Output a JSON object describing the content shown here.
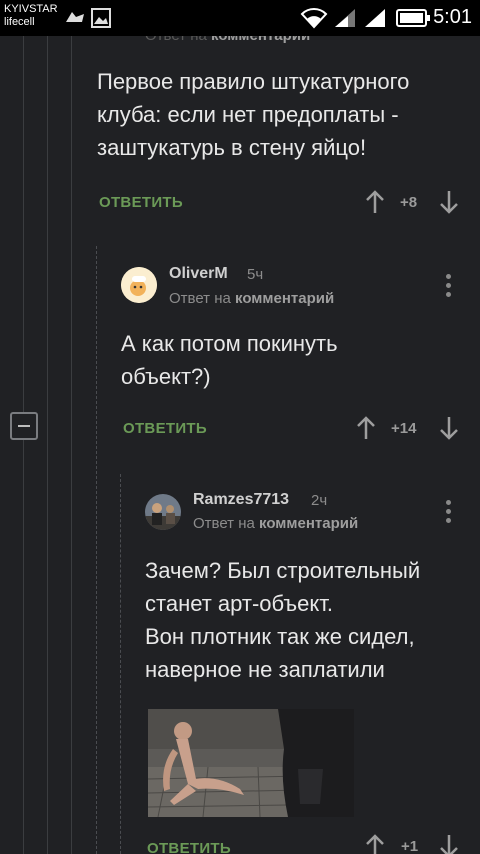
{
  "status_bar": {
    "carrier_1": "KYIVSTAR",
    "carrier_2": "lifecell",
    "time": "5:01"
  },
  "comments": [
    {
      "reply_to_prefix": "Ответ на",
      "reply_to_target": "комментарий",
      "text_lines": [
        "Первое правило штукатурного",
        "клуба: если нет предоплаты -",
        "заштукатурь в стену яйцо!"
      ],
      "reply_label": "ОТВЕТИТЬ",
      "rating": "+8"
    },
    {
      "author": "OliverM",
      "time": "5ч",
      "reply_to_prefix": "Ответ на",
      "reply_to_target": "комментарий",
      "text_lines": [
        "А как потом покинуть",
        "объект?)"
      ],
      "reply_label": "ОТВЕТИТЬ",
      "rating": "+14"
    },
    {
      "author": "Ramzes7713",
      "time": "2ч",
      "reply_to_prefix": "Ответ на",
      "reply_to_target": "комментарий",
      "text_lines": [
        "Зачем? Был строительный",
        "станет арт-объект.",
        "Вон плотник так же сидел,",
        "наверное не заплатили"
      ],
      "reply_label": "ОТВЕТИТЬ",
      "rating": "+1"
    }
  ],
  "icons": {
    "signal": "signal-icon",
    "wifi": "wifi-icon",
    "battery": "battery-icon",
    "upvote": "arrow-up-icon",
    "downvote": "arrow-down-icon",
    "more": "more-vertical-icon",
    "collapse": "minus-icon"
  },
  "colors": {
    "background": "#202124",
    "accent_reply": "#6b9a57",
    "status_bar": "#000000"
  }
}
